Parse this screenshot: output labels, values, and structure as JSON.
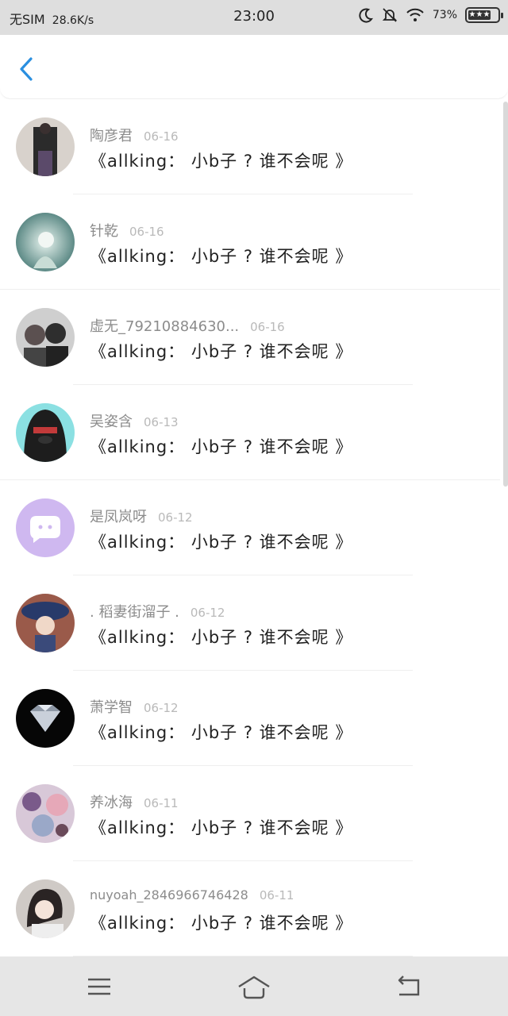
{
  "status": {
    "carrier": "无SIM",
    "speed": "28.6K/s",
    "time": "23:00",
    "battery": "73%"
  },
  "colors": {
    "accent": "#2a8fe0",
    "status_bg": "#dedede",
    "bottom_bg": "#e6e6e6"
  },
  "nav": {
    "back_icon": "chevron-left-icon"
  },
  "messages": [
    {
      "name": "陶彦君",
      "date": "06-16",
      "text": "《allking： 小b子 ? 谁不会呢 》"
    },
    {
      "name": "针乾",
      "date": "06-16",
      "text": "《allking： 小b子 ? 谁不会呢 》"
    },
    {
      "name": "虚无_79210884630...",
      "date": "06-16",
      "text": "《allking： 小b子 ? 谁不会呢 》"
    },
    {
      "name": "吴姿含",
      "date": "06-13",
      "text": "《allking： 小b子 ? 谁不会呢 》"
    },
    {
      "name": "是凤岚呀",
      "date": "06-12",
      "text": "《allking： 小b子 ? 谁不会呢 》"
    },
    {
      "name": ". 稻妻街溜子 .",
      "date": "06-12",
      "text": "《allking： 小b子 ? 谁不会呢 》"
    },
    {
      "name": "萧学智",
      "date": "06-12",
      "text": "《allking： 小b子 ? 谁不会呢 》"
    },
    {
      "name": "养冰海",
      "date": "06-11",
      "text": "《allking： 小b子 ? 谁不会呢 》"
    },
    {
      "name": "nuyoah_2846966746428",
      "date": "06-11",
      "text": "《allking： 小b子 ? 谁不会呢 》"
    }
  ],
  "bottom_nav": [
    "menu-icon",
    "home-icon",
    "back-icon"
  ]
}
